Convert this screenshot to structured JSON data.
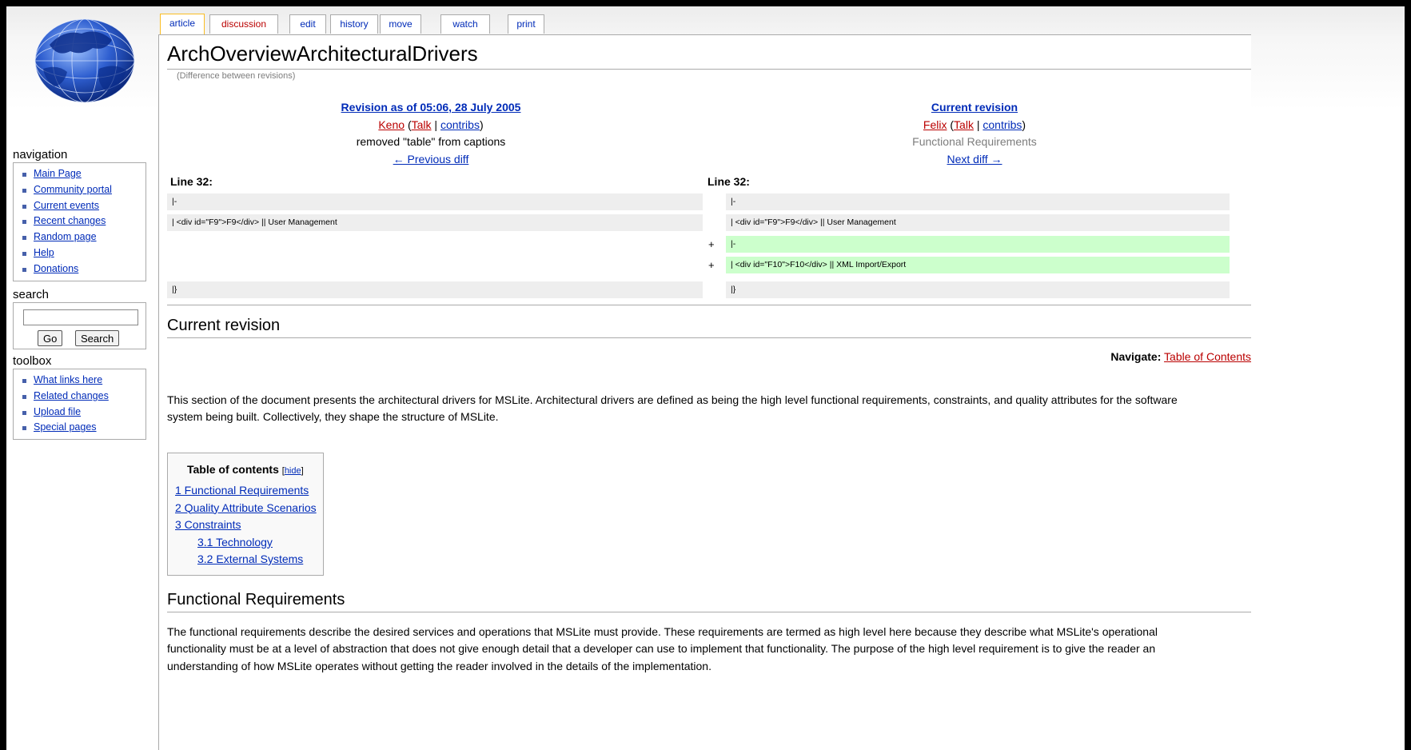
{
  "tabs": [
    {
      "label": "article",
      "selected": true,
      "new": false
    },
    {
      "label": "discussion",
      "selected": false,
      "new": true
    },
    {
      "label": "edit",
      "selected": false,
      "new": false
    },
    {
      "label": "history",
      "selected": false,
      "new": false
    },
    {
      "label": "move",
      "selected": false,
      "new": false
    },
    {
      "label": "watch",
      "selected": false,
      "new": false
    },
    {
      "label": "print",
      "selected": false,
      "new": false
    }
  ],
  "sidebar": {
    "navigation_title": "navigation",
    "navigation_items": [
      "Main Page",
      "Community portal",
      "Current events",
      "Recent changes",
      "Random page",
      "Help",
      "Donations"
    ],
    "search_title": "search",
    "search_value": "",
    "go_label": "Go",
    "search_label": "Search",
    "toolbox_title": "toolbox",
    "toolbox_items": [
      "What links here",
      "Related changes",
      "Upload file",
      "Special pages"
    ]
  },
  "page": {
    "title": "ArchOverviewArchitecturalDrivers",
    "subtitle": "(Difference between revisions)"
  },
  "diff": {
    "left": {
      "heading": "Revision as of 05:06, 28 July 2005",
      "user": "Keno",
      "talk": "Talk",
      "contribs": "contribs",
      "comment": "removed \"table\" from captions",
      "nav": "← Previous diff",
      "line": "Line 32:"
    },
    "right": {
      "heading": "Current revision",
      "user": "Felix",
      "talk": "Talk",
      "contribs": "contribs",
      "comment": "Functional Requirements",
      "nav": "Next diff →",
      "line": "Line 32:"
    },
    "paren_open": "(",
    "separator": " | ",
    "paren_close": ")",
    "plus": "+",
    "rows": {
      "r1_left": "|-",
      "r1_right": "|-",
      "r2_left": "| <div id=\"F9\">F9</div> || User Management",
      "r2_right": "| <div id=\"F9\">F9</div> || User Management",
      "r3_right": "|-",
      "r4_right": "| <div id=\"F10\">F10</div> || XML Import/Export",
      "r5_left": "|}",
      "r5_right": "|}"
    }
  },
  "current_revision": {
    "heading": "Current revision",
    "navigate_label": "Navigate:",
    "navigate_link": "Table of Contents",
    "intro_1": "This section of the document presents the architectural drivers for MSLite. Architectural drivers are defined as being the high level functional requirements, constraints, and quality attributes for the software",
    "intro_2": "system being built. Collectively, they shape the structure of MSLite."
  },
  "toc": {
    "title": "Table of contents",
    "hide_open": "[",
    "hide": "hide",
    "hide_close": "]",
    "items": [
      "1 Functional Requirements",
      "2 Quality Attribute Scenarios",
      "3 Constraints",
      "3.1 Technology",
      "3.2 External Systems"
    ]
  },
  "functional": {
    "heading": "Functional Requirements",
    "p1": "The functional requirements describe the desired services and operations that MSLite must provide. These requirements are termed as high level here because they describe what MSLite's operational",
    "p2": "functionality must be at a level of abstraction that does not give enough detail that a developer can use to implement that functionality. The purpose of the high level requirement is to give the reader an",
    "p3": "understanding of how MSLite operates without getting the reader involved in the details of the implementation."
  },
  "colors": {
    "link": "#002bb8",
    "new_link": "#ba0000",
    "added_line": "#ccffcc",
    "context_line": "#eeeeee",
    "selected_tab": "#fabd23"
  }
}
